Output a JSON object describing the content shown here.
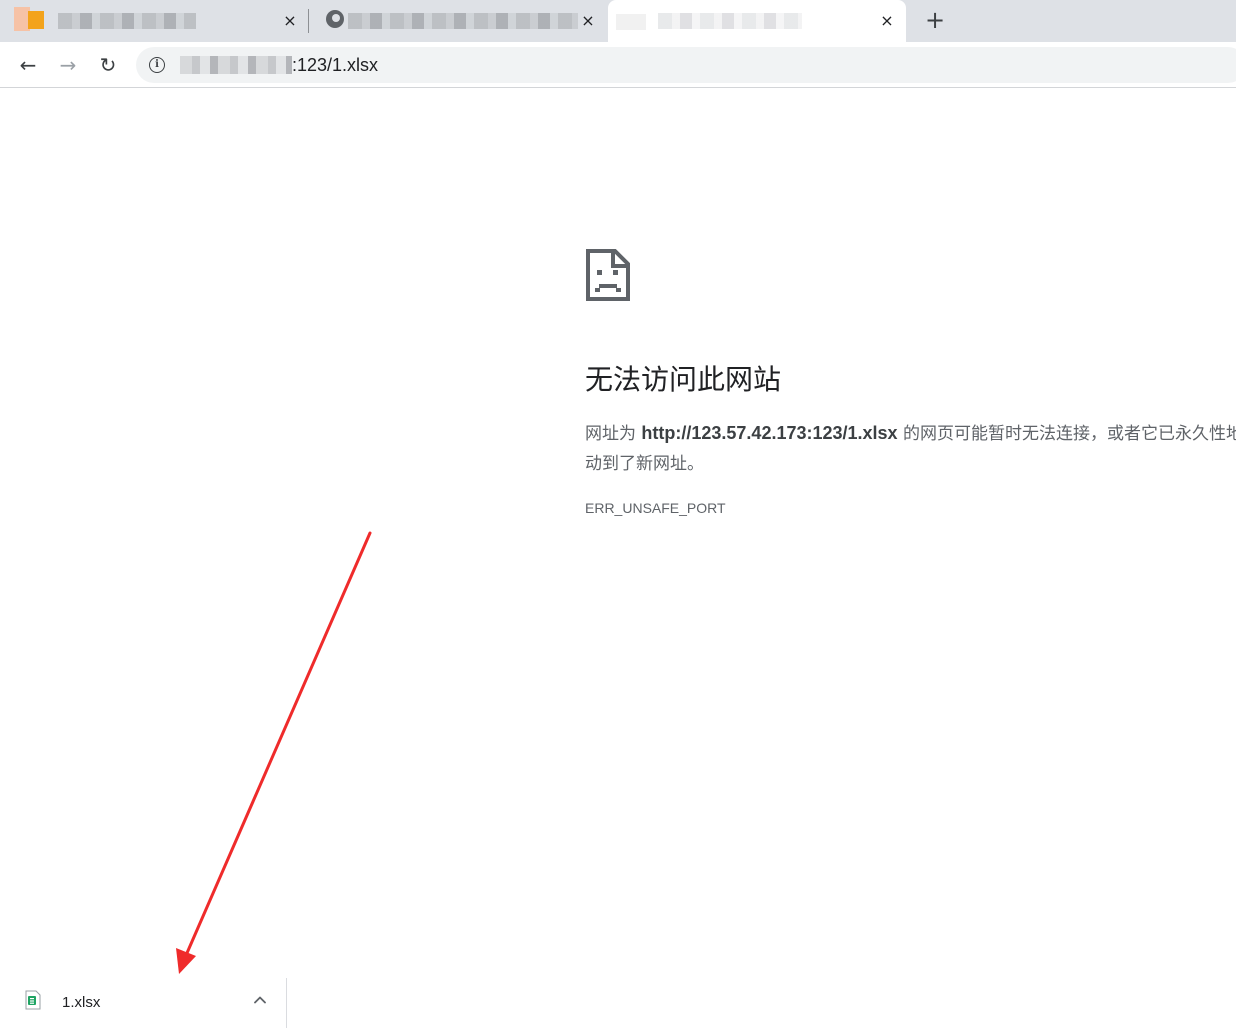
{
  "tabs": [
    {
      "title": "",
      "close_icon": "close-icon",
      "favicon": "site-favicon"
    },
    {
      "title": "",
      "close_icon": "close-icon",
      "favicon": "globe-favicon"
    },
    {
      "title": "",
      "close_icon": "close-icon",
      "favicon": "page-favicon",
      "active": true
    }
  ],
  "tabstrip": {
    "new_tab_symbol": "+",
    "close_symbol": "×"
  },
  "toolbar": {
    "back_symbol": "←",
    "forward_symbol": "→",
    "reload_symbol": "↻",
    "info_symbol": "i",
    "url_visible": ":123/1.xlsx"
  },
  "error": {
    "icon": "sad-document-icon",
    "title": "无法访问此网站",
    "desc_prefix": "网址为 ",
    "desc_url": "http://123.57.42.173:123/1.xlsx",
    "desc_middle": " 的网页可能暂时无法连接，或者它已永久性地移",
    "desc_line2": "动到了新网址。",
    "code": "ERR_UNSAFE_PORT"
  },
  "downloads": {
    "file_name": "1.xlsx",
    "file_icon": "xlsx-file-icon",
    "chevron_icon": "chevron-up-icon"
  },
  "colors": {
    "tabstrip": "#dee1e6",
    "active_tab": "#ffffff",
    "omnibox": "#f1f3f4",
    "title_text": "#202124",
    "body_text": "#5f6368",
    "annotation_arrow": "#ef2b2b",
    "excel_green": "#1fa463"
  }
}
